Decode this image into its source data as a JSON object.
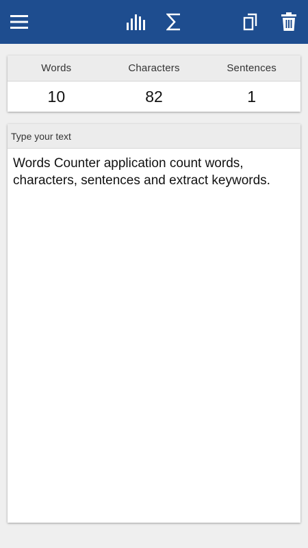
{
  "toolbar": {
    "icons": [
      "menu-icon",
      "bar-chart-icon",
      "sigma-icon",
      "copy-icon",
      "trash-icon"
    ]
  },
  "stats": {
    "columns": [
      {
        "label": "Words",
        "value": "10"
      },
      {
        "label": "Characters",
        "value": "82"
      },
      {
        "label": "Sentences",
        "value": "1"
      }
    ]
  },
  "editor": {
    "label": "Type your text",
    "text": "Words Counter application count words, characters, sentences and extract keywords."
  },
  "colors": {
    "toolbar_bg": "#1e4d8f",
    "background": "#efefef",
    "card_header_bg": "#ececec"
  }
}
